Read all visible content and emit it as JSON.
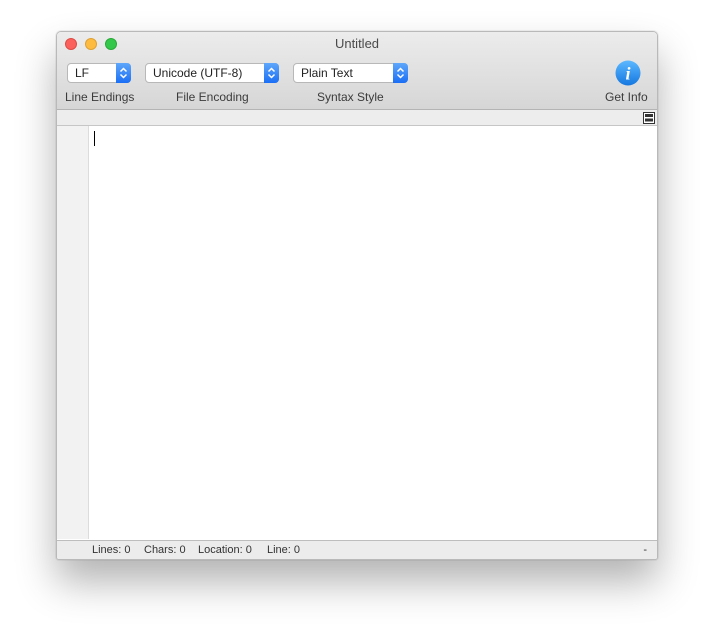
{
  "window": {
    "title": "Untitled"
  },
  "toolbar": {
    "line_endings": {
      "value": "LF",
      "label": "Line Endings"
    },
    "file_encoding": {
      "value": "Unicode (UTF-8)",
      "label": "File Encoding"
    },
    "syntax_style": {
      "value": "Plain Text",
      "label": "Syntax Style"
    },
    "get_info": {
      "label": "Get Info",
      "icon": "info-icon"
    }
  },
  "editor": {
    "content": ""
  },
  "statusbar": {
    "lines": "Lines: 0",
    "chars": "Chars: 0",
    "location": "Location: 0",
    "line": "Line: 0",
    "right": "-"
  },
  "colors": {
    "close": "#fc605c",
    "minimize": "#fdbc40",
    "zoom": "#34c84a",
    "popup_arrow": "#1b6ff5",
    "info_icon": "#1d8ef0"
  }
}
